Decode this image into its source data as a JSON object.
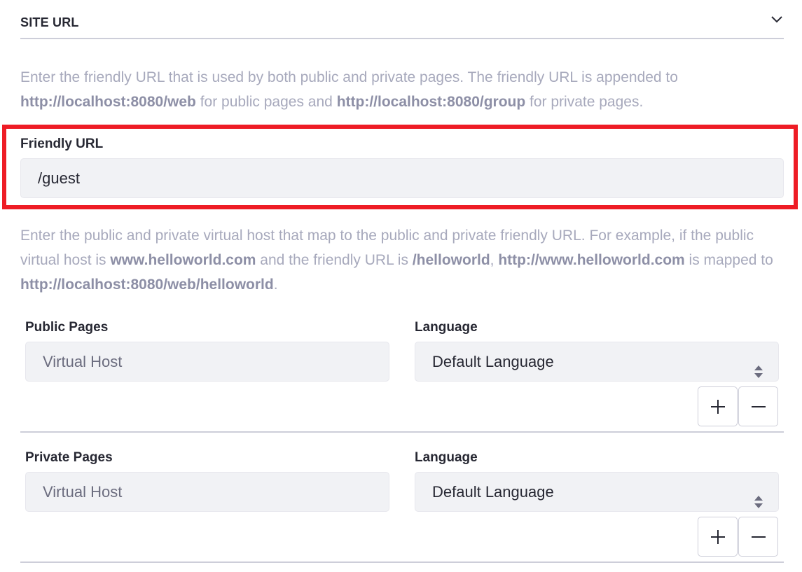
{
  "section": {
    "title": "SITE URL",
    "toggle_icon": "chevron-down-icon"
  },
  "description1": {
    "p1": "Enter the friendly URL that is used by both public and private pages. The friendly URL is appended to ",
    "b1": "http://localhost:8080/web",
    "p2": " for public pages and ",
    "b2": "http://localhost:8080/group",
    "p3": " for private pages."
  },
  "friendly_url": {
    "label": "Friendly URL",
    "value": "/guest"
  },
  "description2": {
    "p1": "Enter the public and private virtual host that map to the public and private friendly URL. For example, if the public virtual host is ",
    "b1": "www.helloworld.com",
    "p2": " and the friendly URL is ",
    "b2": "/helloworld",
    "p3": ", ",
    "b3": "http://www.helloworld.com",
    "p4": " is mapped to ",
    "b4": "http://localhost:8080/web/helloworld",
    "p5": "."
  },
  "public_pages": {
    "label": "Public Pages",
    "placeholder": "Virtual Host",
    "language_label": "Language",
    "language_value": "Default Language",
    "add_icon": "plus-icon",
    "remove_icon": "minus-icon"
  },
  "private_pages": {
    "label": "Private Pages",
    "placeholder": "Virtual Host",
    "language_label": "Language",
    "language_value": "Default Language",
    "add_icon": "plus-icon",
    "remove_icon": "minus-icon"
  },
  "colors": {
    "highlight": "#ee1c25",
    "input_bg": "#f1f2f5",
    "muted_text": "#a7a9bc"
  }
}
